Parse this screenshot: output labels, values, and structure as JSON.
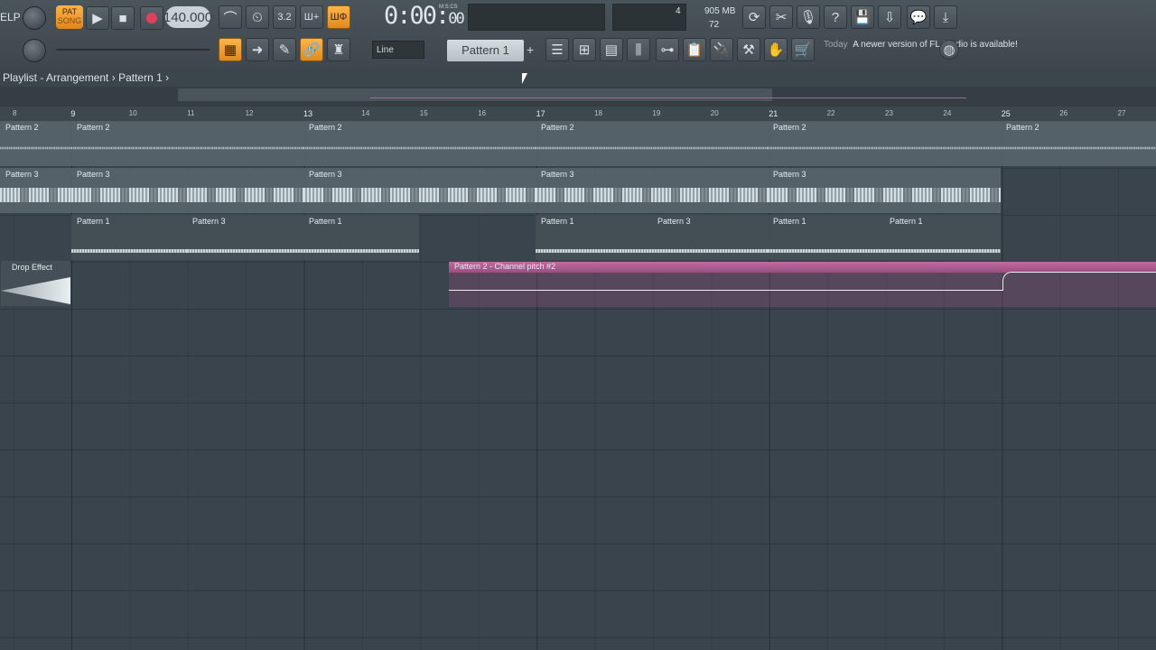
{
  "toolbar": {
    "mode_badge": "PAT",
    "mode_badge_sub": "SONG",
    "tempo": "140.000",
    "time_main": "0:00:",
    "time_sub": "00",
    "time_label": "M:S:CS",
    "cpu_value": "4",
    "memory": "905 MB",
    "poly": "72",
    "snap_mode": "Line",
    "pattern_selected": "Pattern 1",
    "news_date": "Today",
    "news_text": "A newer version of FL Studio is available!",
    "left_edge_text": "ELP"
  },
  "window": {
    "title": "Playlist - Arrangement",
    "breadcrumb_sep": "›",
    "breadcrumb_pattern": "Pattern 1"
  },
  "ruler": {
    "bars": [
      "8",
      "9",
      "10",
      "11",
      "12",
      "13",
      "14",
      "15",
      "16",
      "17",
      "18",
      "19",
      "20",
      "21",
      "22",
      "23",
      "24",
      "25",
      "26",
      "27"
    ]
  },
  "tracks": {
    "row1": [
      "Pattern 2",
      "Pattern 2",
      "Pattern 2",
      "Pattern 2",
      "Pattern 2"
    ],
    "row2": [
      "Pattern 3",
      "Pattern 3",
      "Pattern 3",
      "Pattern 3",
      "Pattern 3"
    ],
    "row3": [
      "Pattern 1",
      "Pattern 3",
      "Pattern 1",
      "Pattern 1",
      "Pattern 3",
      "Pattern 1",
      "Pattern 1"
    ],
    "drop": "Drop Effect",
    "automation": "Pattern 2 - Channel pitch #2"
  },
  "colors": {
    "accent": "#ffb347",
    "automation": "#c06aa0",
    "background": "#3a444c"
  }
}
